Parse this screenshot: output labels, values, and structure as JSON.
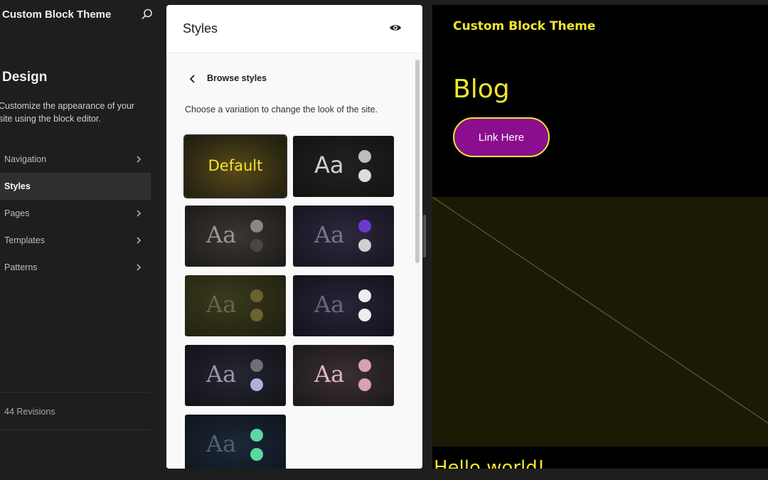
{
  "sidebar": {
    "site_title": "Custom Block Theme",
    "heading": "Design",
    "description": "Customize the appearance of your site using the block editor.",
    "nav_items": [
      {
        "label": "Navigation",
        "has_chevron": true,
        "active": false
      },
      {
        "label": "Styles",
        "has_chevron": false,
        "active": true
      },
      {
        "label": "Pages",
        "has_chevron": true,
        "active": false
      },
      {
        "label": "Templates",
        "has_chevron": true,
        "active": false
      },
      {
        "label": "Patterns",
        "has_chevron": true,
        "active": false
      }
    ],
    "revisions": "44 Revisions"
  },
  "panel": {
    "title": "Styles",
    "browse_title": "Browse styles",
    "browse_description": "Choose a variation to change the look of the site.",
    "variations": [
      {
        "label": "Default",
        "selected": true,
        "bg": "#3a3312",
        "text_color": "#f1e62a"
      },
      {
        "label": "Aa",
        "bg": "#1a1a1a",
        "text_color": "#cfcfcf",
        "dot1": "#bdbdbd",
        "dot2": "#dcdcdc"
      },
      {
        "label": "Aa",
        "bg": "#2a2724",
        "text_color": "#9a9691",
        "dot1": "#888888",
        "dot2": "#4a4642"
      },
      {
        "label": "Aa",
        "bg": "#201c2c",
        "text_color": "#7a7585",
        "dot1": "#6a3ad0",
        "dot2": "#d0d0d0"
      },
      {
        "label": "Aa",
        "bg": "#262618",
        "text_color": "#6a6448",
        "dot1": "#6a6230",
        "dot2": "#6a6230"
      },
      {
        "label": "Aa",
        "bg": "#1c1a26",
        "text_color": "#6c6878",
        "dot1": "#eeeeee",
        "dot2": "#eeeeee"
      },
      {
        "label": "Aa",
        "bg": "#1a1a22",
        "text_color": "#9a98a4",
        "dot1": "#707070",
        "dot2": "#b0b0e0"
      },
      {
        "label": "Aa",
        "bg": "#2a2428",
        "text_color": "#e5b4c6",
        "dot1": "#d8a0b4",
        "dot2": "#d8a0b4"
      },
      {
        "label": "Aa",
        "bg": "#131a24",
        "text_color": "#556070",
        "dot1": "#5ad8a0",
        "dot2": "#5ad8a0"
      }
    ]
  },
  "preview": {
    "site_title": "Custom Block Theme",
    "heading": "Blog",
    "button_label": "Link Here",
    "post_title": "Hello world!",
    "accent": "#f1e62a",
    "button_bg": "#8a0e8e"
  }
}
